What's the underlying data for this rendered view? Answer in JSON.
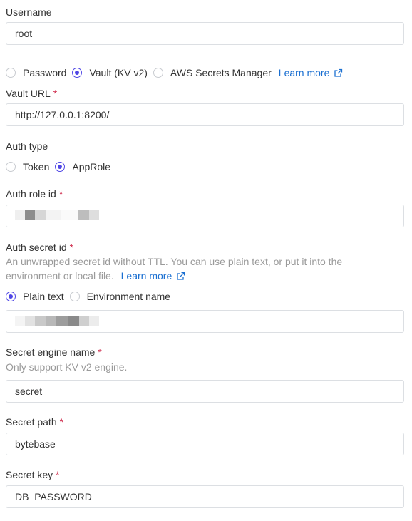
{
  "username": {
    "label": "Username",
    "value": "root"
  },
  "source": {
    "options": [
      "Password",
      "Vault (KV v2)",
      "AWS Secrets Manager"
    ],
    "selected": "Vault (KV v2)",
    "learn_more": "Learn more"
  },
  "vault_url": {
    "label": "Vault URL",
    "required": "*",
    "value": "http://127.0.0.1:8200/"
  },
  "auth_type": {
    "label": "Auth type",
    "options": [
      "Token",
      "AppRole"
    ],
    "selected": "AppRole"
  },
  "auth_role_id": {
    "label": "Auth role id",
    "required": "*",
    "value": ""
  },
  "auth_secret_id": {
    "label": "Auth secret id",
    "required": "*",
    "hint": "An unwrapped secret id without TTL. You can use plain text, or put it into the environment or local file.",
    "learn_more": "Learn more",
    "options": [
      "Plain text",
      "Environment name"
    ],
    "selected": "Plain text",
    "value": ""
  },
  "secret_engine_name": {
    "label": "Secret engine name",
    "required": "*",
    "hint": "Only support KV v2 engine.",
    "value": "secret"
  },
  "secret_path": {
    "label": "Secret path",
    "required": "*",
    "value": "bytebase"
  },
  "secret_key": {
    "label": "Secret key",
    "required": "*",
    "value": "DB_PASSWORD"
  },
  "colors": {
    "accent": "#4f46e5",
    "link": "#1a6fd1",
    "required": "#d03050"
  }
}
